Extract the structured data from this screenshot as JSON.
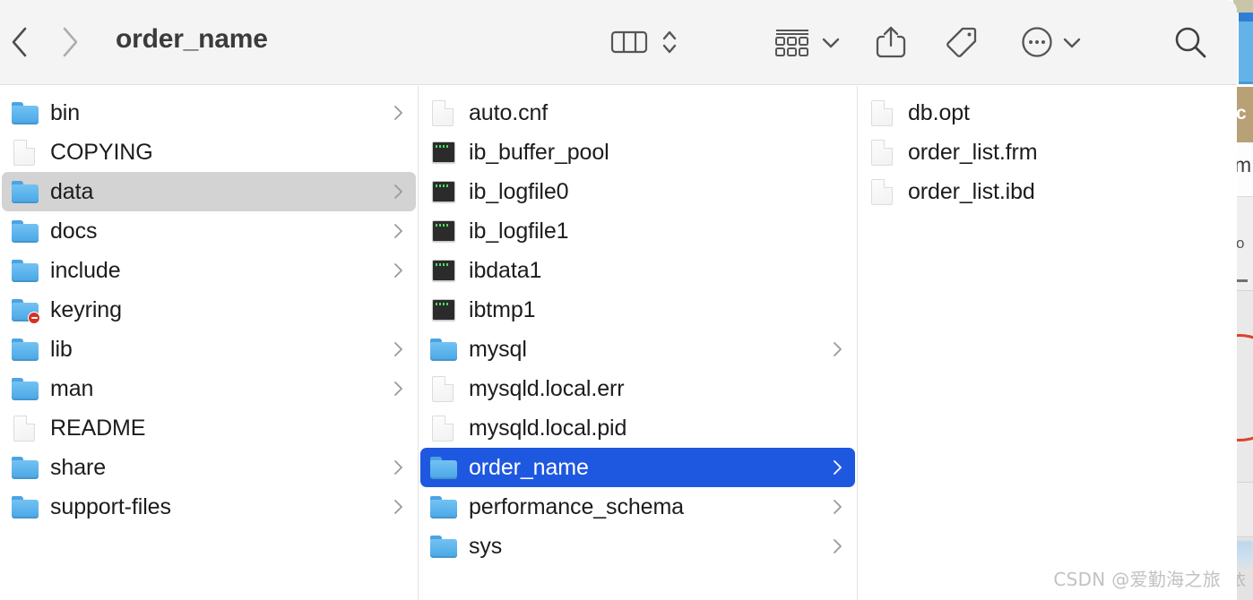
{
  "window": {
    "title": "order_name",
    "accent_selection_color": "#1f58e0",
    "inactive_selection_color": "#d3d3d3",
    "toolbar_background": "#f4f4f4",
    "folder_color": "#5bb3ec"
  },
  "toolbar": {
    "back_label": "Back",
    "forward_label": "Forward",
    "buttons": [
      {
        "name": "view-column-icon",
        "label": "Column View"
      },
      {
        "name": "view-stepper-icon",
        "label": "View Options"
      },
      {
        "name": "group-by-icon",
        "label": "Group Items"
      },
      {
        "name": "group-chevron-icon",
        "label": "Group Options"
      },
      {
        "name": "share-icon",
        "label": "Share"
      },
      {
        "name": "tag-icon",
        "label": "Tags"
      },
      {
        "name": "more-icon",
        "label": "More"
      },
      {
        "name": "more-chevron-icon",
        "label": "More Options"
      },
      {
        "name": "search-icon",
        "label": "Search"
      }
    ]
  },
  "columns": [
    {
      "id": "column-1",
      "items": [
        {
          "name": "bin",
          "icon": "folder",
          "chevron": true,
          "selected": false
        },
        {
          "name": "COPYING",
          "icon": "document",
          "chevron": false,
          "selected": false
        },
        {
          "name": "data",
          "icon": "folder",
          "chevron": true,
          "selected": "gray"
        },
        {
          "name": "docs",
          "icon": "folder",
          "chevron": true,
          "selected": false
        },
        {
          "name": "include",
          "icon": "folder",
          "chevron": true,
          "selected": false
        },
        {
          "name": "keyring",
          "icon": "folder-restricted",
          "chevron": false,
          "selected": false
        },
        {
          "name": "lib",
          "icon": "folder",
          "chevron": true,
          "selected": false
        },
        {
          "name": "man",
          "icon": "folder",
          "chevron": true,
          "selected": false
        },
        {
          "name": "README",
          "icon": "document",
          "chevron": false,
          "selected": false
        },
        {
          "name": "share",
          "icon": "folder",
          "chevron": true,
          "selected": false
        },
        {
          "name": "support-files",
          "icon": "folder",
          "chevron": true,
          "selected": false
        }
      ]
    },
    {
      "id": "column-2",
      "items": [
        {
          "name": "auto.cnf",
          "icon": "document",
          "chevron": false,
          "selected": false
        },
        {
          "name": "ib_buffer_pool",
          "icon": "terminal",
          "chevron": false,
          "selected": false
        },
        {
          "name": "ib_logfile0",
          "icon": "terminal",
          "chevron": false,
          "selected": false
        },
        {
          "name": "ib_logfile1",
          "icon": "terminal",
          "chevron": false,
          "selected": false
        },
        {
          "name": "ibdata1",
          "icon": "terminal",
          "chevron": false,
          "selected": false
        },
        {
          "name": "ibtmp1",
          "icon": "terminal",
          "chevron": false,
          "selected": false
        },
        {
          "name": "mysql",
          "icon": "folder",
          "chevron": true,
          "selected": false
        },
        {
          "name": "mysqld.local.err",
          "icon": "document",
          "chevron": false,
          "selected": false
        },
        {
          "name": "mysqld.local.pid",
          "icon": "document",
          "chevron": false,
          "selected": false
        },
        {
          "name": "order_name",
          "icon": "folder",
          "chevron": true,
          "selected": "blue"
        },
        {
          "name": "performance_schema",
          "icon": "folder",
          "chevron": true,
          "selected": false
        },
        {
          "name": "sys",
          "icon": "folder",
          "chevron": true,
          "selected": false
        }
      ]
    },
    {
      "id": "column-3",
      "items": [
        {
          "name": "db.opt",
          "icon": "document",
          "chevron": false,
          "selected": false
        },
        {
          "name": "order_list.frm",
          "icon": "document",
          "chevron": false,
          "selected": false
        },
        {
          "name": "order_list.ibd",
          "icon": "document",
          "chevron": false,
          "selected": false
        }
      ]
    }
  ],
  "background_window": {
    "glyph_c": "c",
    "glyph_m": "m",
    "glyph_o": "o",
    "cjk_fragment": "依"
  },
  "watermark": {
    "text": "CSDN @爱勤海之旅"
  }
}
